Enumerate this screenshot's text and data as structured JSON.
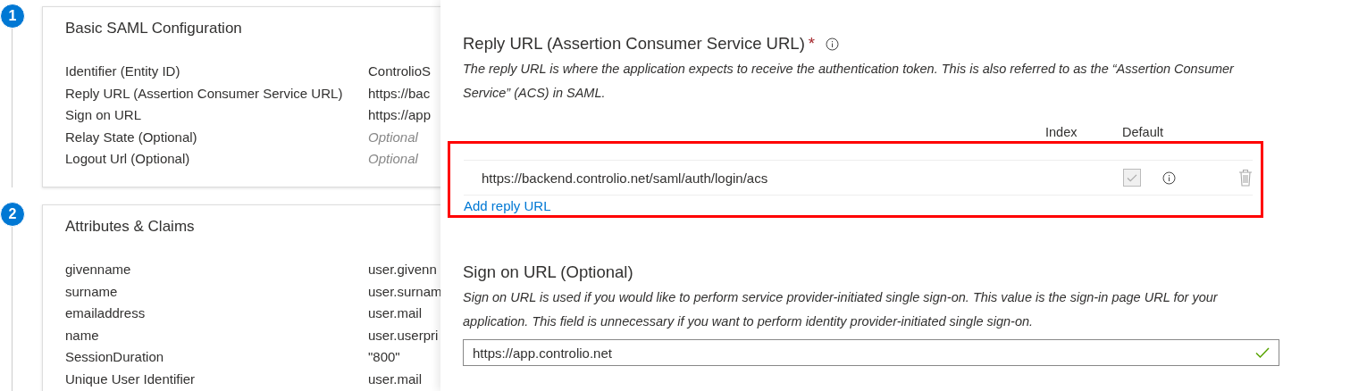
{
  "steps": [
    {
      "number": "1",
      "title": "Basic SAML Configuration",
      "rows": [
        {
          "label": "Identifier (Entity ID)",
          "value": "ControlioS",
          "kind": "value"
        },
        {
          "label": "Reply URL (Assertion Consumer Service URL)",
          "value": "https://bac",
          "kind": "value"
        },
        {
          "label": "Sign on URL",
          "value": "https://app",
          "kind": "value"
        },
        {
          "label": "Relay State (Optional)",
          "value": "Optional",
          "kind": "placeholder"
        },
        {
          "label": "Logout Url (Optional)",
          "value": "Optional",
          "kind": "placeholder"
        }
      ]
    },
    {
      "number": "2",
      "title": "Attributes & Claims",
      "rows": [
        {
          "label": "givenname",
          "value": "user.givenn",
          "kind": "value"
        },
        {
          "label": "surname",
          "value": "user.surnam",
          "kind": "value"
        },
        {
          "label": "emailaddress",
          "value": "user.mail",
          "kind": "value"
        },
        {
          "label": "name",
          "value": "user.userpri",
          "kind": "value"
        },
        {
          "label": "SessionDuration",
          "value": "\"800\"",
          "kind": "value"
        },
        {
          "label": "Unique User Identifier",
          "value": "user.mail",
          "kind": "value"
        }
      ]
    }
  ],
  "panel": {
    "reply_url": {
      "title": "Reply URL (Assertion Consumer Service URL)",
      "required_mark": "*",
      "description": "The reply URL is where the application expects to receive the authentication token. This is also referred to as the “Assertion Consumer Service” (ACS) in SAML.",
      "highlighted": true,
      "columns": [
        "Index",
        "Default"
      ],
      "urls": [
        {
          "url": "https://backend.controlio.net/saml/auth/login/acs",
          "default_checked": true,
          "disabled": true
        }
      ],
      "add_link": "Add reply URL"
    },
    "sign_on": {
      "title": "Sign on URL (Optional)",
      "description": "Sign on URL is used if you would like to perform service provider-initiated single sign-on. This value is the sign-in page URL for your application. This field is unnecessary if you want to perform identity provider-initiated single sign-on.",
      "value": "https://app.controlio.net",
      "valid": true
    }
  }
}
